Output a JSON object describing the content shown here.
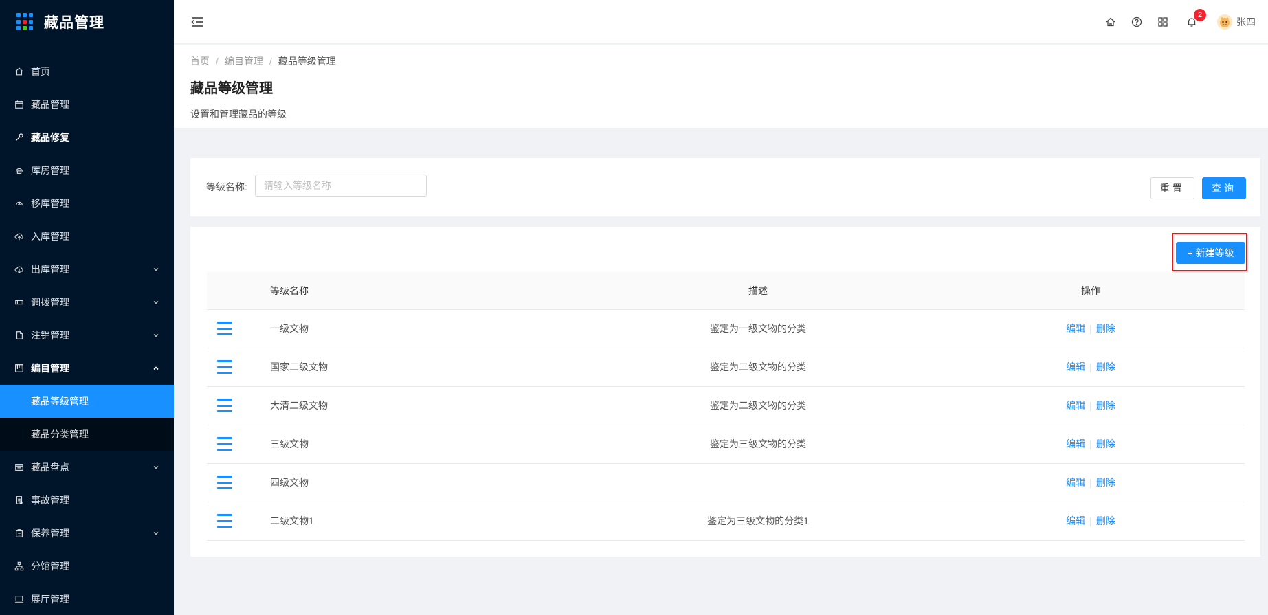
{
  "app": {
    "title": "藏品管理",
    "logo_dot_colors": [
      "#1890ff",
      "#1890ff",
      "#1890ff",
      "#1890ff",
      "#f5222d",
      "#1890ff",
      "#1890ff",
      "#52c41a",
      "#1890ff"
    ]
  },
  "sidebar": {
    "items": [
      {
        "label": "首页",
        "icon": "home-icon"
      },
      {
        "label": "藏品管理",
        "icon": "calendar-icon"
      },
      {
        "label": "藏品修复",
        "icon": "wrench-icon"
      },
      {
        "label": "库房管理",
        "icon": "warehouse-icon"
      },
      {
        "label": "移库管理",
        "icon": "move-icon"
      },
      {
        "label": "入库管理",
        "icon": "cloud-upload-icon"
      },
      {
        "label": "出库管理",
        "icon": "cloud-download-icon"
      },
      {
        "label": "调拨管理",
        "icon": "transfer-icon"
      },
      {
        "label": "注销管理",
        "icon": "file-icon"
      },
      {
        "label": "编目管理",
        "icon": "catalog-icon"
      },
      {
        "label": "藏品盘点",
        "icon": "inventory-icon"
      },
      {
        "label": "事故管理",
        "icon": "report-icon"
      },
      {
        "label": "保养管理",
        "icon": "maintain-icon"
      },
      {
        "label": "分馆管理",
        "icon": "branch-icon"
      },
      {
        "label": "展厅管理",
        "icon": "monitor-icon"
      }
    ],
    "submenu": [
      {
        "label": "藏品等级管理",
        "active": true
      },
      {
        "label": "藏品分类管理",
        "active": false
      }
    ]
  },
  "header": {
    "notification_count": "2",
    "username": "张四"
  },
  "page": {
    "breadcrumb": [
      "首页",
      "编目管理",
      "藏品等级管理"
    ],
    "breadcrumb_sep": "/",
    "title": "藏品等级管理",
    "description": "设置和管理藏品的等级"
  },
  "search": {
    "label": "等级名称:",
    "placeholder": "请输入等级名称",
    "value": "",
    "reset_label": "重置",
    "query_label": "查询"
  },
  "table": {
    "new_button_label": "+ 新建等级",
    "columns": [
      "等级名称",
      "描述",
      "操作"
    ],
    "rows": [
      {
        "name": "一级文物",
        "desc": "鉴定为一级文物的分类"
      },
      {
        "name": "国家二级文物",
        "desc": "鉴定为二级文物的分类"
      },
      {
        "name": "大清二级文物",
        "desc": "鉴定为二级文物的分类"
      },
      {
        "name": "三级文物",
        "desc": "鉴定为三级文物的分类"
      },
      {
        "name": "四级文物",
        "desc": ""
      },
      {
        "name": "二级文物1",
        "desc": "鉴定为三级文物的分类1"
      }
    ],
    "edit_label": "编辑",
    "delete_label": "删除"
  },
  "colors": {
    "sidebar_bg": "#001529",
    "submenu_bg": "#000c17",
    "primary": "#1890ff",
    "danger": "#f5222d",
    "highlight_box": "#e8191a"
  }
}
